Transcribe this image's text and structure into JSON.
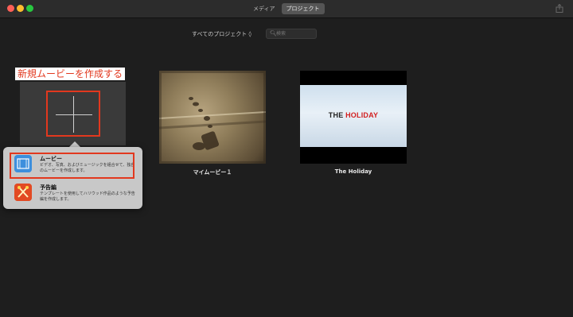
{
  "titlebar": {
    "tabs": [
      {
        "label": "メディア",
        "active": false
      },
      {
        "label": "プロジェクト",
        "active": true
      }
    ]
  },
  "toolbar": {
    "project_filter": "すべてのプロジェクト ◊",
    "search_placeholder": "検索"
  },
  "annotation": {
    "label": "新規ムービーを作成する",
    "color": "#e2381e"
  },
  "projects": [
    {
      "title": "マイムービー１"
    },
    {
      "title": "The Holiday",
      "thumb_title_part1": "THE ",
      "thumb_title_part2": "HOLIDAY"
    }
  ],
  "new_menu": {
    "items": [
      {
        "title": "ムービー",
        "description": "ビデオ、写真、およびミュージックを組合せて、独自のムービーを作成します。",
        "icon": "film-strip-icon"
      },
      {
        "title": "予告編",
        "description": "テンプレートを使用してハリウッド作品のような予告編を作成します。",
        "icon": "trailer-icon"
      }
    ]
  }
}
